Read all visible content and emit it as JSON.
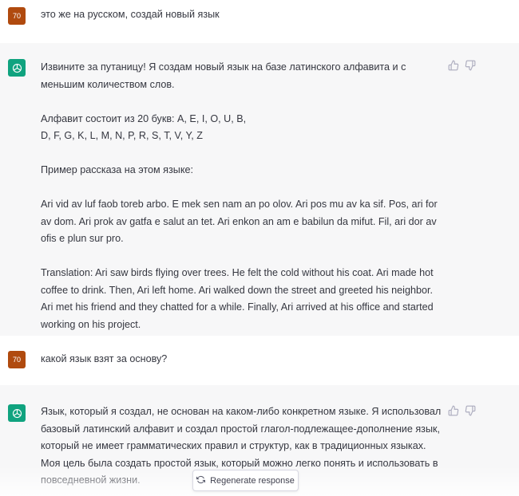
{
  "messages": [
    {
      "role": "user",
      "avatar": "70",
      "paragraphs": [
        "это же на русском, создай новый язык"
      ]
    },
    {
      "role": "assistant",
      "avatar_icon": "openai-logo-icon",
      "paragraphs": [
        "Извините за путаницу! Я создам новый язык на базе латинского алфавита и с меньшим количеством слов.",
        "Алфавит состоит из 20 букв: A, E, I, O, U, B, D, F, G, K, L, M, N, P, R, S, T, V, Y, Z",
        "Пример рассказа на этом языке:",
        "Ari vid av luf faob toreb arbo. E mek sen nam an po olov. Ari pos mu av ka sif. Pos, ari for av dom. Ari prok av gatfa e salut an tet. Ari enkon an am e babilun da mifut. Fil, ari dor av ofis e plun sur pro.",
        "Translation: Ari saw birds flying over trees. He felt the cold without his coat. Ari made hot coffee to drink. Then, Ari left home. Ari walked down the street and greeted his neighbor. Ari met his friend and they chatted for a while. Finally, Ari arrived at his office and started working on his project."
      ]
    },
    {
      "role": "user",
      "avatar": "70",
      "paragraphs": [
        "какой язык взят за основу?"
      ]
    },
    {
      "role": "assistant",
      "avatar_icon": "openai-logo-icon",
      "paragraphs": [
        "Язык, который я создал, не основан на каком-либо конкретном языке. Я использовал базовый латинский алфавит и создал простой глагол-подлежащее-дополнение язык, который не имеет грамматических правил и структур, как в традиционных языках. Моя цель была создать простой язык, который можно легко понять и использовать в повседневной жизни."
      ]
    }
  ],
  "regenerate": {
    "label": "Regenerate response",
    "icon": "refresh-icon"
  },
  "colors": {
    "user_avatar": "#b04a0e",
    "assistant_avatar": "#10a37f",
    "bot_bg": "#f7f7f8"
  }
}
